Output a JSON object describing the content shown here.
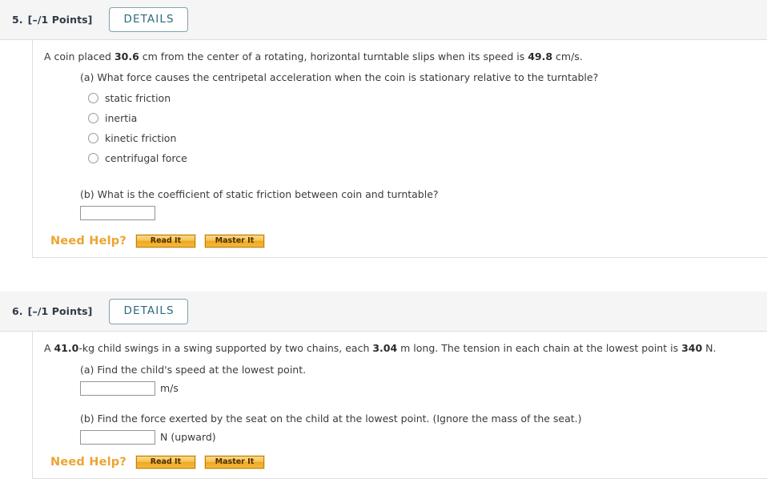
{
  "questions": [
    {
      "number": "5.",
      "points": "[–/1 Points]",
      "details_label": "DETAILS",
      "stem_pre": "A coin placed ",
      "stem_val1": "30.6",
      "stem_mid": " cm from the center of a rotating, horizontal turntable slips when its speed is ",
      "stem_val2": "49.8",
      "stem_post": " cm/s.",
      "part_a": {
        "prompt": "(a) What force causes the centripetal acceleration when the coin is stationary relative to the turntable?",
        "options": [
          "static friction",
          "inertia",
          "kinetic friction",
          "centrifugal force"
        ]
      },
      "part_b": {
        "prompt": "(b) What is the coefficient of static friction between coin and turntable?",
        "value": "",
        "unit": ""
      },
      "need_help": {
        "label": "Need Help?",
        "read_it": "Read It",
        "master_it": "Master It"
      }
    },
    {
      "number": "6.",
      "points": "[–/1 Points]",
      "details_label": "DETAILS",
      "stem_pre": "A ",
      "stem_val1": "41.0",
      "stem_mid": "-kg child swings in a swing supported by two chains, each ",
      "stem_val2": "3.04",
      "stem_mid2": " m long. The tension in each chain at the lowest point is ",
      "stem_val3": "340",
      "stem_post": " N.",
      "part_a": {
        "prompt": "(a) Find the child's speed at the lowest point.",
        "value": "",
        "unit": "m/s"
      },
      "part_b": {
        "prompt": "(b) Find the force exerted by the seat on the child at the lowest point. (Ignore the mass of the seat.)",
        "value": "",
        "unit": "N (upward)"
      },
      "need_help": {
        "label": "Need Help?",
        "read_it": "Read It",
        "master_it": "Master It"
      }
    }
  ],
  "colors": {
    "header_bg": "#f5f5f5",
    "details_text": "#2d6a80",
    "need_help_orange": "#eda430",
    "button_orange": "#f0a81e"
  }
}
